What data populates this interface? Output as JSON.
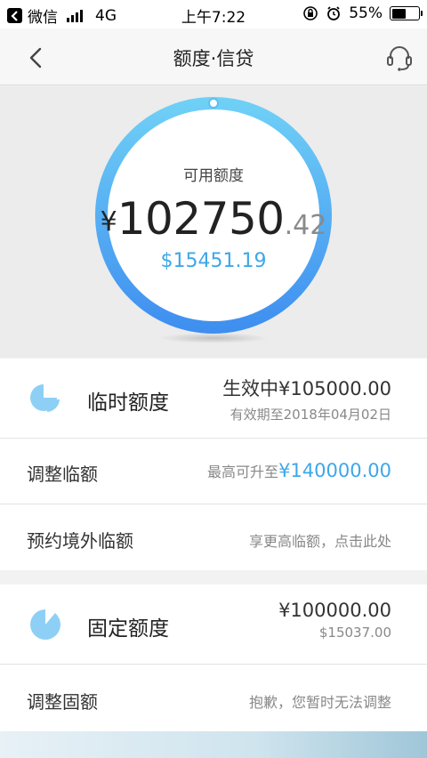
{
  "status_bar": {
    "app": "微信",
    "network": "4G",
    "time": "上午7:22",
    "battery": "55%",
    "battery_level": 0.55
  },
  "nav": {
    "title": "额度·信贷",
    "back_icon": "chevron-left-icon",
    "service_icon": "headset-icon"
  },
  "hero": {
    "label": "可用额度",
    "currency_symbol": "¥",
    "amount_integer": "102750",
    "amount_decimal": ".42",
    "usd_amount": "$15451.19",
    "ring_color": "#4aa8f0"
  },
  "temporary": {
    "title": "临时额度",
    "status": "生效中¥105000.00",
    "valid_until": "有效期至2018年04月02日",
    "icon": "pie-chart-icon"
  },
  "adjust_temporary": {
    "label": "调整临额",
    "hint_prefix": "最高可升至",
    "hint_amount": "¥140000.00"
  },
  "reserve_overseas": {
    "label": "预约境外临额",
    "hint": "享更高临额，点击此处"
  },
  "fixed": {
    "title": "固定额度",
    "amount": "¥100000.00",
    "usd": "$15037.00",
    "icon": "pie-chart-icon"
  },
  "adjust_fixed": {
    "label": "调整固额",
    "hint": "抱歉，您暂时无法调整"
  },
  "colors": {
    "accent": "#3da7e8",
    "pie": "#8ed0f5"
  }
}
